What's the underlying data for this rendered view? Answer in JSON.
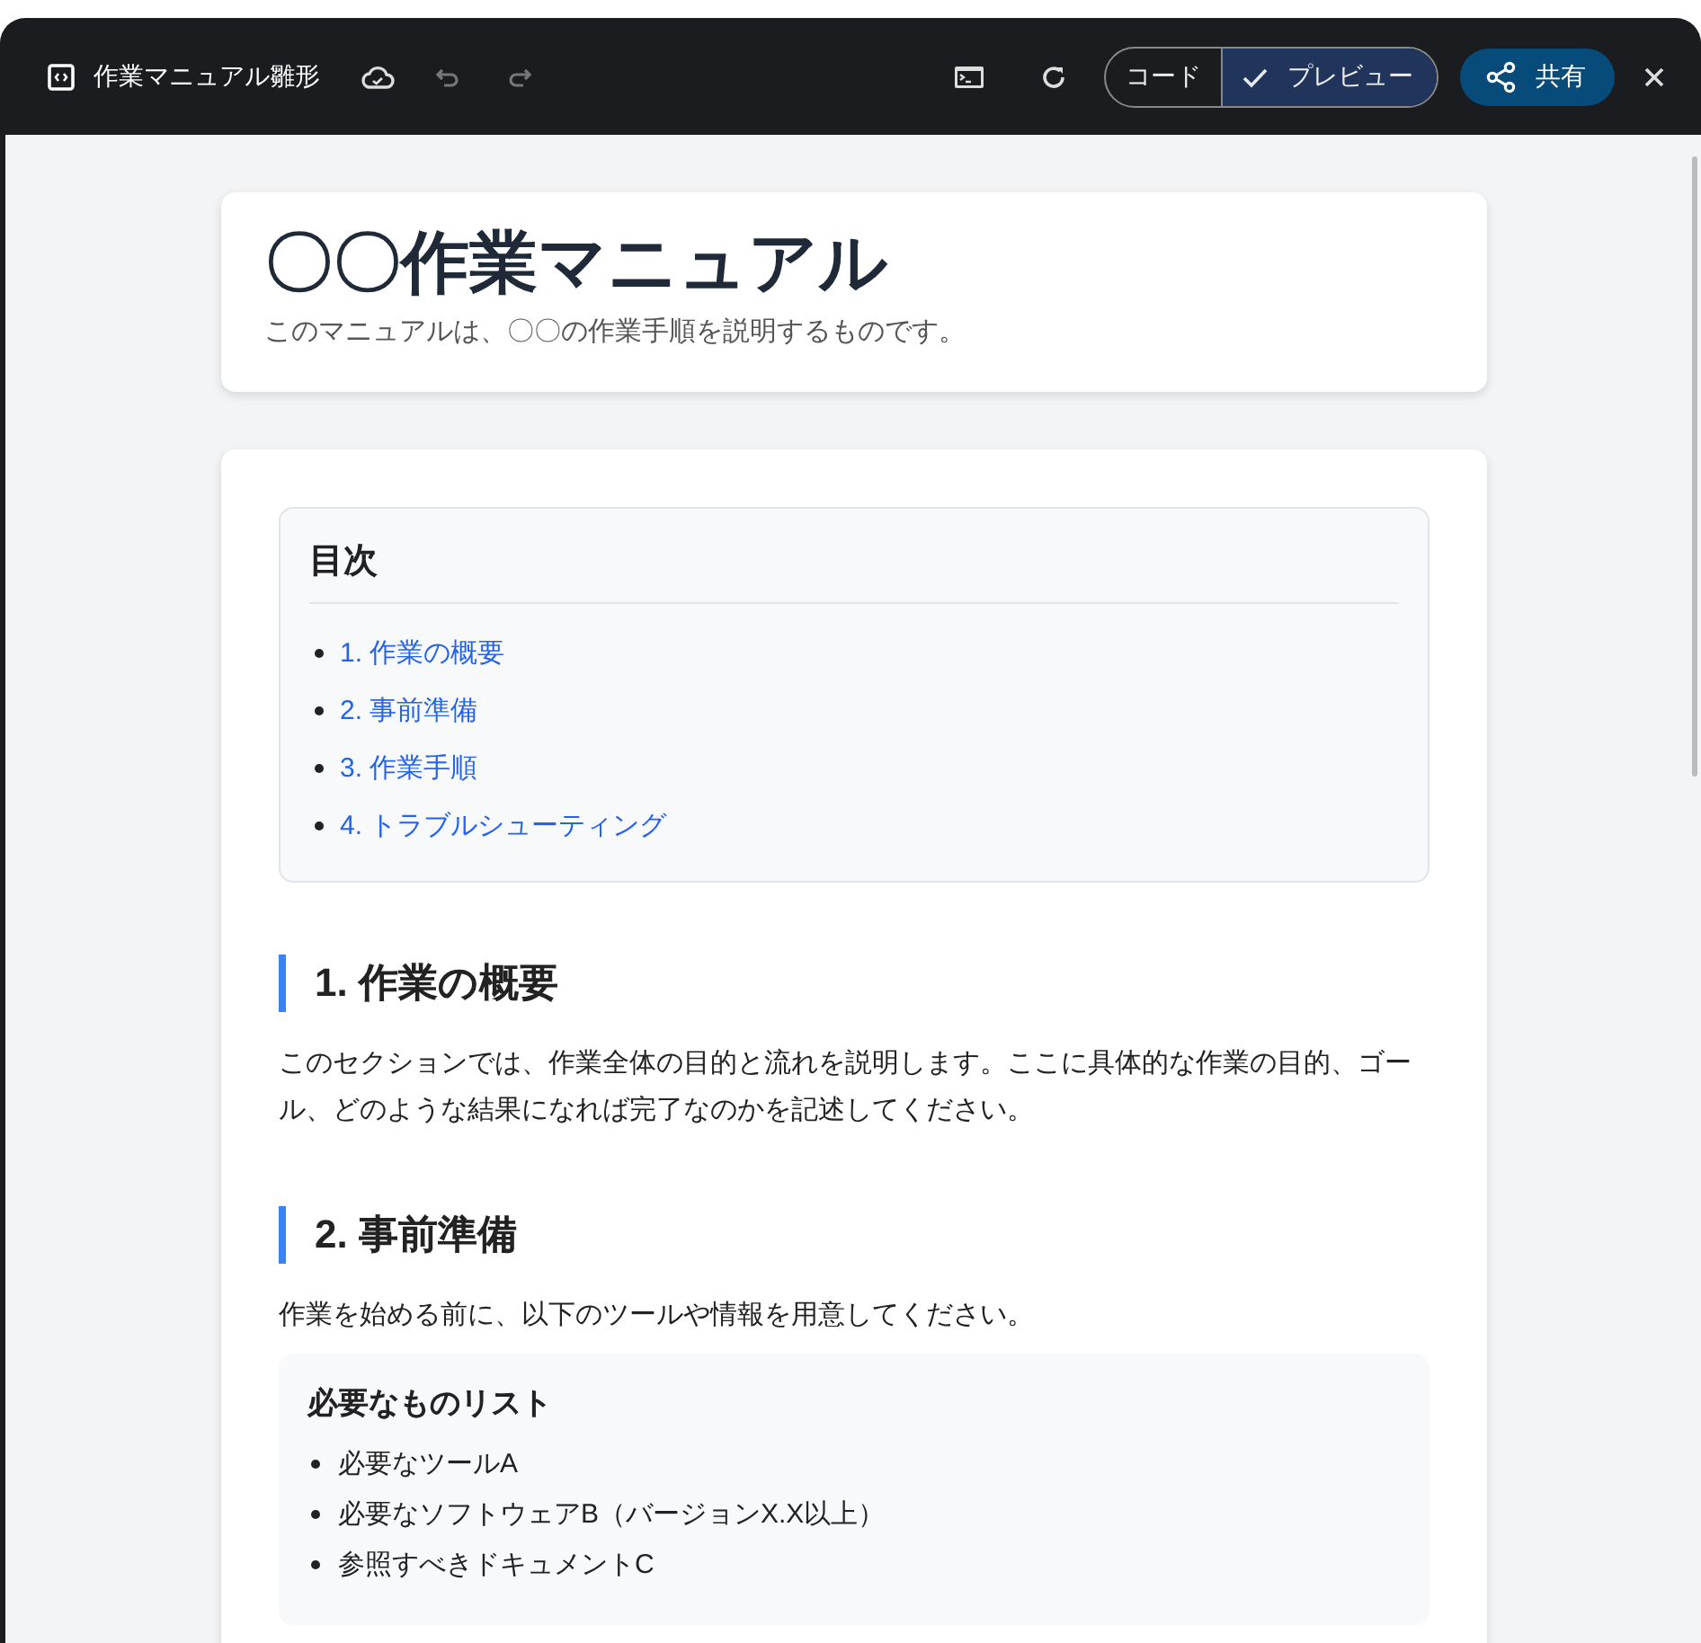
{
  "toolbar": {
    "title": "作業マニュアル雛形",
    "view_toggle": [
      {
        "label": "コード",
        "selected": false
      },
      {
        "label": "プレビュー",
        "selected": true
      }
    ],
    "share_label": "共有"
  },
  "header": {
    "title": "〇〇作業マニュアル",
    "subtitle": "このマニュアルは、〇〇の作業手順を説明するものです。"
  },
  "toc": {
    "title": "目次",
    "items": [
      "1. 作業の概要",
      "2. 事前準備",
      "3. 作業手順",
      "4. トラブルシューティング"
    ]
  },
  "sections": [
    {
      "heading": "1. 作業の概要",
      "text": "このセクションでは、作業全体の目的と流れを説明します。ここに具体的な作業の目的、ゴール、どのような結果になれば完了なのかを記述してください。"
    },
    {
      "heading": "2. 事前準備",
      "text": "作業を始める前に、以下のツールや情報を用意してください。",
      "box": {
        "title": "必要なものリスト",
        "items": [
          "必要なツールA",
          "必要なソフトウェアB（バージョンX.X以上）",
          "参照すべきドキュメントC"
        ]
      }
    }
  ]
}
